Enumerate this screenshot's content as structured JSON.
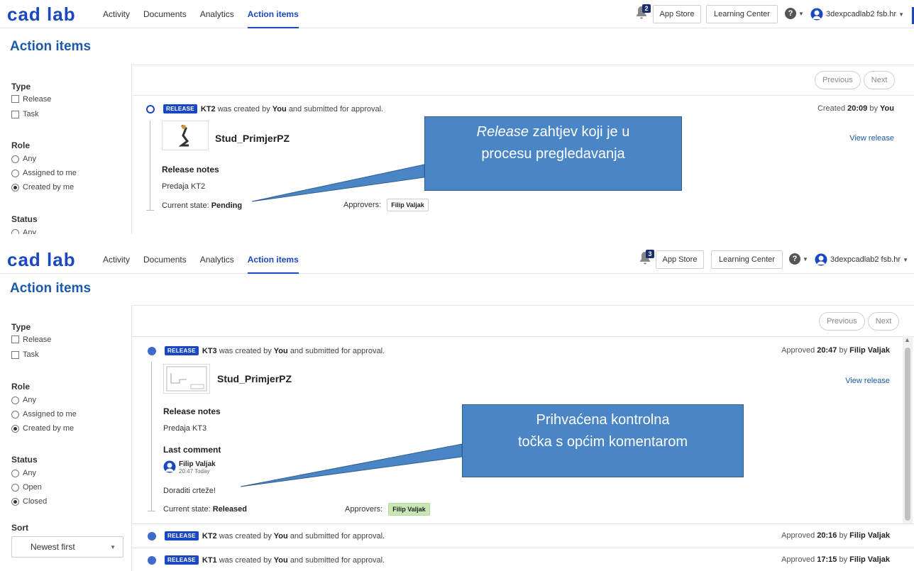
{
  "nav": {
    "logo": "cad lab",
    "links": [
      "Activity",
      "Documents",
      "Analytics",
      "Action items"
    ],
    "app_store": "App Store",
    "learning_center": "Learning Center",
    "help_glyph": "?",
    "user": "3dexpcadlab2 fsb.hr"
  },
  "panels": [
    {
      "notifications": "2",
      "page_title": "Action items",
      "filters": {
        "type_title": "Type",
        "type_options": [
          "Release",
          "Task"
        ],
        "role_title": "Role",
        "role_options": [
          "Any",
          "Assigned to me",
          "Created by me"
        ],
        "status_title": "Status",
        "status_options": [
          "Any"
        ]
      },
      "pager": {
        "previous": "Previous",
        "next": "Next"
      },
      "item": {
        "badge": "RELEASE",
        "doc": "KT2",
        "created_phrase": "was created by",
        "who": "You",
        "approval_phrase": "and submitted for approval.",
        "meta_prefix": "Created",
        "meta_time": "20:09",
        "meta_by": "by",
        "meta_user": "You",
        "document_name": "Stud_PrimjerPZ",
        "view_release": "View release",
        "release_notes_label": "Release notes",
        "release_notes": "Predaja KT2",
        "state_label": "Current state:",
        "state": "Pending",
        "approvers_label": "Approvers:",
        "approver": "Filip Valjak"
      },
      "callout": {
        "em": "Release",
        "rest_line1": "zahtjev koji je u",
        "line2": "procesu pregledavanja"
      }
    },
    {
      "notifications": "3",
      "page_title": "Action items",
      "filters": {
        "type_title": "Type",
        "type_options": [
          "Release",
          "Task"
        ],
        "role_title": "Role",
        "role_options": [
          "Any",
          "Assigned to me",
          "Created by me"
        ],
        "status_title": "Status",
        "status_options": [
          "Any",
          "Open",
          "Closed"
        ],
        "sort_title": "Sort",
        "sort_value": "Newest first"
      },
      "pager": {
        "previous": "Previous",
        "next": "Next"
      },
      "item": {
        "badge": "RELEASE",
        "doc": "KT3",
        "created_phrase": "was created by",
        "who": "You",
        "approval_phrase": "and submitted for approval.",
        "meta_prefix": "Approved",
        "meta_time": "20:47",
        "meta_by": "by",
        "meta_user": "Filip Valjak",
        "document_name": "Stud_PrimjerPZ",
        "view_release": "View release",
        "release_notes_label": "Release notes",
        "release_notes": "Predaja KT3",
        "last_comment_label": "Last comment",
        "commenter": "Filip Valjak",
        "comment_time": "20:47 Today",
        "comment": "Doraditi crteže!",
        "state_label": "Current state:",
        "state": "Released",
        "approvers_label": "Approvers:",
        "approver": "Filip Valjak"
      },
      "rows": [
        {
          "badge": "RELEASE",
          "doc": "KT2",
          "created_phrase": "was created by",
          "who": "You",
          "approval_phrase": "and submitted for approval.",
          "meta_prefix": "Approved",
          "meta_time": "20:16",
          "meta_by": "by",
          "meta_user": "Filip Valjak"
        },
        {
          "badge": "RELEASE",
          "doc": "KT1",
          "created_phrase": "was created by",
          "who": "You",
          "approval_phrase": "and submitted for approval.",
          "meta_prefix": "Approved",
          "meta_time": "17:15",
          "meta_by": "by",
          "meta_user": "Filip Valjak"
        }
      ],
      "callout": {
        "line1": "Prihvaćena kontrolna",
        "line2": "točka s općim komentarom"
      }
    }
  ],
  "colors": {
    "brand": "#1a47c2",
    "title": "#1a5aa8",
    "callout": "#4a86c5",
    "approved_chip": "#c7e7b5"
  }
}
